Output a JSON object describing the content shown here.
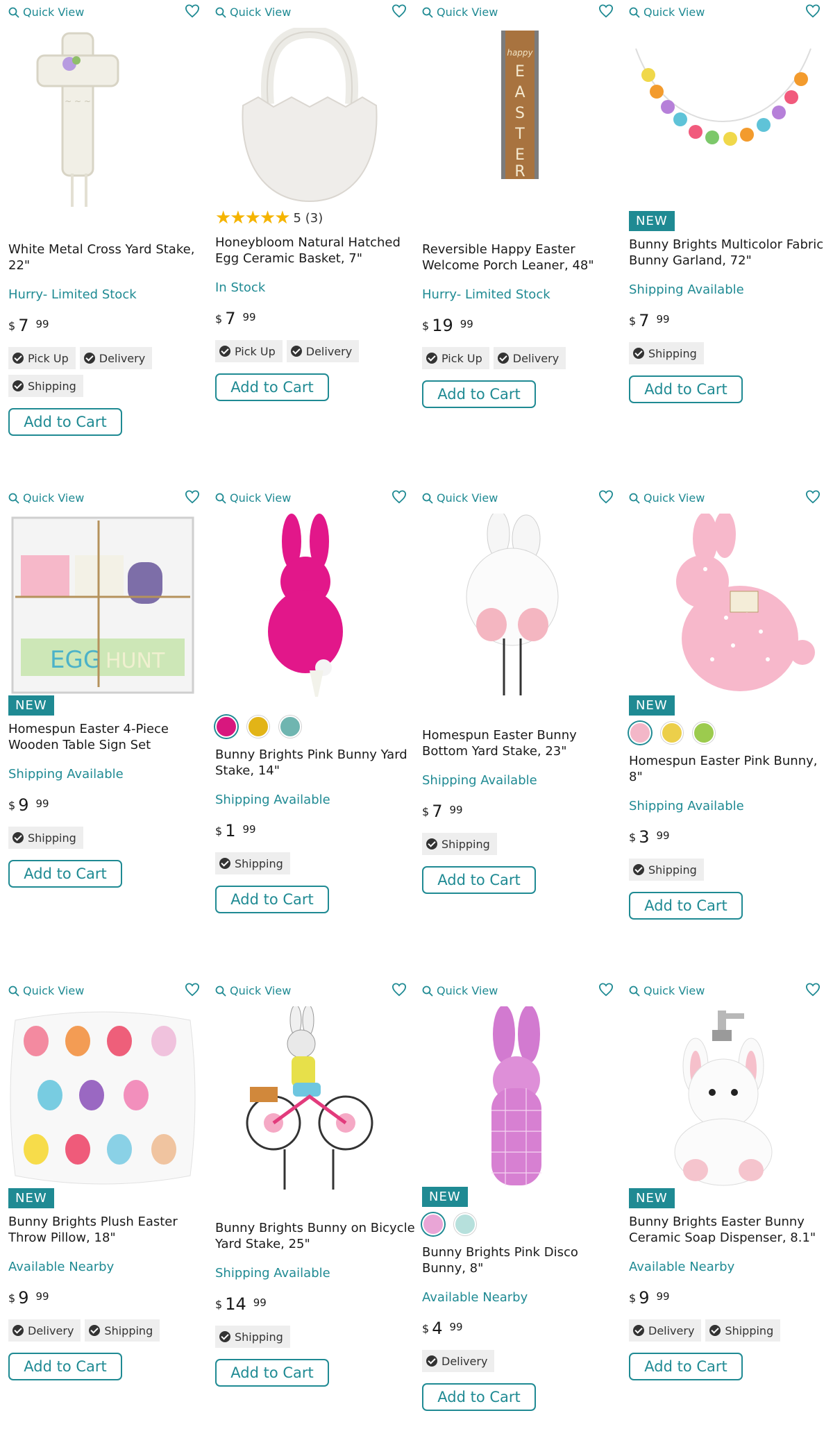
{
  "common": {
    "quick_view_label": "Quick View",
    "add_to_cart_label": "Add to Cart",
    "new_label": "NEW",
    "currency": "$"
  },
  "products": [
    {
      "id": "p1",
      "title": "White Metal Cross Yard Stake, 22\"",
      "availability": "Hurry- Limited Stock",
      "price_dollars": "7",
      "price_cents": "99",
      "fulfillment": [
        "Pick Up",
        "Delivery",
        "Shipping"
      ],
      "new": false,
      "swatches": [],
      "rating": null
    },
    {
      "id": "p2",
      "title": "Honeybloom Natural Hatched Egg Ceramic Basket, 7\"",
      "availability": "In Stock",
      "price_dollars": "7",
      "price_cents": "99",
      "fulfillment": [
        "Pick Up",
        "Delivery"
      ],
      "new": false,
      "swatches": [],
      "rating": {
        "stars": "★★★★★",
        "text": "5 (3)"
      }
    },
    {
      "id": "p3",
      "title": "Reversible Happy Easter Welcome Porch Leaner, 48\"",
      "availability": "Hurry- Limited Stock",
      "price_dollars": "19",
      "price_cents": "99",
      "fulfillment": [
        "Pick Up",
        "Delivery"
      ],
      "new": false,
      "swatches": [],
      "rating": null
    },
    {
      "id": "p4",
      "title": "Bunny Brights Multicolor Fabric Bunny Garland, 72\"",
      "availability": "Shipping Available",
      "price_dollars": "7",
      "price_cents": "99",
      "fulfillment": [
        "Shipping"
      ],
      "new": true,
      "swatches": [],
      "rating": null
    },
    {
      "id": "p5",
      "title": "Homespun Easter 4-Piece Wooden Table Sign Set",
      "availability": "Shipping Available",
      "price_dollars": "9",
      "price_cents": "99",
      "fulfillment": [
        "Shipping"
      ],
      "new": true,
      "swatches": [],
      "rating": null
    },
    {
      "id": "p6",
      "title": "Bunny Brights Pink Bunny Yard Stake, 14\"",
      "availability": "Shipping Available",
      "price_dollars": "1",
      "price_cents": "99",
      "fulfillment": [
        "Shipping"
      ],
      "new": false,
      "swatches": [
        "#d8177e",
        "#e2b417",
        "#6fb5b0"
      ],
      "rating": null
    },
    {
      "id": "p7",
      "title": "Homespun Easter Bunny Bottom Yard Stake, 23\"",
      "availability": "Shipping Available",
      "price_dollars": "7",
      "price_cents": "99",
      "fulfillment": [
        "Shipping"
      ],
      "new": false,
      "swatches": [],
      "rating": null
    },
    {
      "id": "p8",
      "title": "Homespun Easter Pink Bunny, 8\"",
      "availability": "Shipping Available",
      "price_dollars": "3",
      "price_cents": "99",
      "fulfillment": [
        "Shipping"
      ],
      "new": true,
      "swatches": [
        "#f3b7c8",
        "#eccf4a",
        "#9ccb4e"
      ],
      "rating": null
    },
    {
      "id": "p9",
      "title": "Bunny Brights Plush Easter Throw Pillow, 18\"",
      "availability": "Available Nearby",
      "price_dollars": "9",
      "price_cents": "99",
      "fulfillment": [
        "Delivery",
        "Shipping"
      ],
      "new": true,
      "swatches": [],
      "rating": null
    },
    {
      "id": "p10",
      "title": "Bunny Brights Bunny on Bicycle Yard Stake, 25\"",
      "availability": "Shipping Available",
      "price_dollars": "14",
      "price_cents": "99",
      "fulfillment": [
        "Shipping"
      ],
      "new": false,
      "swatches": [],
      "rating": null
    },
    {
      "id": "p11",
      "title": "Bunny Brights Pink Disco Bunny, 8\"",
      "availability": "Available Nearby",
      "price_dollars": "4",
      "price_cents": "99",
      "fulfillment": [
        "Delivery"
      ],
      "new": true,
      "swatches": [
        "#e9a5d6",
        "#b6e0dc"
      ],
      "rating": null
    },
    {
      "id": "p12",
      "title": "Bunny Brights Easter Bunny Ceramic Soap Dispenser, 8.1\"",
      "availability": "Available Nearby",
      "price_dollars": "9",
      "price_cents": "99",
      "fulfillment": [
        "Delivery",
        "Shipping"
      ],
      "new": true,
      "swatches": [],
      "rating": null
    }
  ],
  "colors": {
    "accent": "#1f8a93",
    "chip_bg": "#eeeeee"
  }
}
